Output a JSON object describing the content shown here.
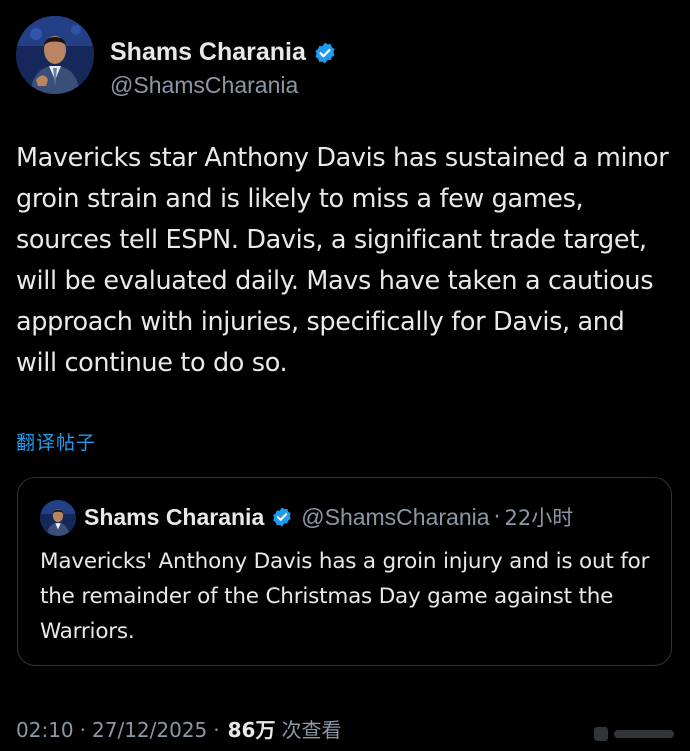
{
  "author": {
    "name": "Shams Charania",
    "handle": "@ShamsCharania",
    "verified_color": "#1d9bf0"
  },
  "tweet": {
    "text": "Mavericks star Anthony Davis has sustained a minor groin strain and is likely to miss a few games, sources tell ESPN. Davis, a significant trade target, will be evaluated daily. Mavs have taken a cautious approach with injuries, specifically for Davis, and will continue to do so.",
    "translate_label": "翻译帖子"
  },
  "quoted": {
    "name": "Shams Charania",
    "handle": "@ShamsCharania",
    "separator": "·",
    "time": "22小时",
    "text": "Mavericks' Anthony Davis has a groin injury and is out for the remainder of the Christmas Day game against the Warriors."
  },
  "meta": {
    "time": "02:10",
    "separator": "·",
    "date": "27/12/2025",
    "views": "86万",
    "views_label": "次查看"
  },
  "colors": {
    "background": "#000000",
    "text": "#e7e9ea",
    "secondary": "#8b98a5",
    "link": "#1d9bf0",
    "border": "#2f3336"
  }
}
